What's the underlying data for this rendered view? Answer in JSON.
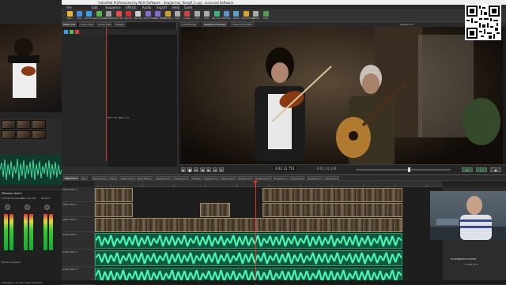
{
  "window": {
    "title": "VideoPad Professional by NCH Software - Seq/Jarmul_Rengif_1.vpj - Licensed Software"
  },
  "menu": [
    "File",
    "Edit",
    "Sequence",
    "Effects",
    "Audio",
    "Export",
    "Help",
    "Suite"
  ],
  "ribbon": [
    {
      "label": "Open",
      "icon": "folder-icon",
      "color": "#e8b339"
    },
    {
      "label": "Save",
      "icon": "save-icon",
      "color": "#4a8de0"
    },
    {
      "label": "Add File(s)",
      "icon": "add-file-icon",
      "color": "#39a0e8"
    },
    {
      "label": "Add Objects",
      "icon": "add-objects-icon",
      "color": "#59b84a"
    },
    {
      "label": "Add Blank",
      "icon": "add-blank-icon",
      "color": "#999999"
    },
    {
      "label": "Add Title",
      "icon": "title-icon",
      "color": "#e05050"
    },
    {
      "label": "Record",
      "icon": "record-icon",
      "color": "#d03030"
    },
    {
      "label": "Narrate",
      "icon": "mic-icon",
      "color": "#cccccc"
    },
    {
      "label": "Video Effects",
      "icon": "video-fx-icon",
      "color": "#8a6ad0"
    },
    {
      "label": "Audio Effects",
      "icon": "audio-fx-icon",
      "color": "#8a6ad0"
    },
    {
      "label": "Transition",
      "icon": "transition-icon",
      "color": "#d0a030"
    },
    {
      "label": "Split",
      "icon": "split-icon",
      "color": "#aaaaaa"
    },
    {
      "label": "Delete",
      "icon": "delete-icon",
      "color": "#d04040"
    },
    {
      "label": "Undo",
      "icon": "undo-icon",
      "color": "#aaaaaa"
    },
    {
      "label": "Redo",
      "icon": "redo-icon",
      "color": "#aaaaaa"
    },
    {
      "label": "Set Audio",
      "icon": "audio-icon",
      "color": "#40b080"
    },
    {
      "label": "Stabilize",
      "icon": "stabilize-icon",
      "color": "#6090d0"
    },
    {
      "label": "Speed",
      "icon": "speed-icon",
      "color": "#60a0d0"
    },
    {
      "label": "Export Movie",
      "icon": "export-icon",
      "color": "#e0a030"
    },
    {
      "label": "Options",
      "icon": "options-icon",
      "color": "#aaaaaa"
    },
    {
      "label": "Suite",
      "icon": "suite-icon",
      "color": "#50a050"
    }
  ],
  "media_panel": {
    "tabs": [
      "Media List",
      "Video Files",
      "Audio Files",
      "Images"
    ],
    "clip_label": "Pack de ribbon (1)"
  },
  "preview": {
    "tabs": [
      "Clip Preview",
      "Sequence Preview",
      "Video Clip Editor"
    ],
    "sequence_label": "Sequence 1",
    "timecode": "0:01:12.753",
    "duration": "0:01:31.130"
  },
  "timeline": {
    "tabs": [
      "Sequence 1",
      "Seq",
      "Sequence 3",
      "Seq B",
      "Sequence B",
      "Back Matery",
      "Sequence 11",
      "Sequence 5",
      "VideoRe",
      "Sequence 2",
      "Sequence 6",
      "Sequence 9",
      "Sequence 10",
      "Sequence 1",
      "Sequence 4",
      "Sequence 7",
      "Sequence 8"
    ],
    "tracks": [
      "Video Track 3",
      "Video Track 2",
      "Video Track 1",
      "Audio Track 1",
      "Audio Track 2",
      "Audio Track 3"
    ]
  },
  "cam_panel": {
    "hint": "Drag clips here to add to end of the sequence",
    "name": "НА ВИДЕОКЛАТУРИЗ",
    "sub": "0 RUB (0%)"
  },
  "left_app": {
    "mixer_title": "Микшер звука",
    "labels": [
      "Устройство вывода",
      "Звук для Ghel",
      "Мик/Aux"
    ],
    "footer": "Пресеты задания"
  },
  "status": "VideoPad v 11.32 © NCH Software"
}
